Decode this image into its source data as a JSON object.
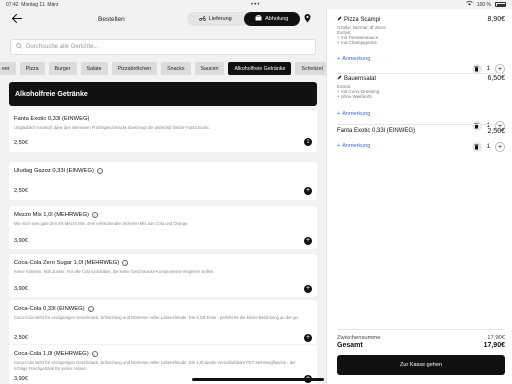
{
  "statusbar": {
    "time": "07:42",
    "date": "Montag 11. März",
    "battery": "100 %"
  },
  "header": {
    "title": "Bestellen",
    "tabs": [
      {
        "label": "Lieferung"
      },
      {
        "label": "Abholung"
      }
    ]
  },
  "search": {
    "placeholder": "Durchsuche alle Gerichte..."
  },
  "categories": [
    "eer",
    "Pizza",
    "Burger",
    "Salate",
    "Pizzabrötchen",
    "Snacks",
    "Saucen",
    "Alkoholfreie Getränke",
    "Schnitzel"
  ],
  "section": {
    "title": "Alkoholfreie Getränke"
  },
  "products": [
    {
      "name": "Fanta Exotic 0,33l (EINWEG)",
      "desc": "Unglaublich exotisch dank des intensiven Fruchtgeschmacks überzeugt die prickelnd frische Fanta Exotic.",
      "price": "2,50€",
      "qty": "1"
    },
    {
      "name": "Uludag Gazoz 0,33l (EINWEG)",
      "desc": "",
      "price": "2,50€"
    },
    {
      "name": "Mezzo Mix 1,0l (MEHRWEG)",
      "desc": "Mix mich eins gute Zeit mit Mezzo Mix, dem erfrischenden leckeren Mix aus Cola und Orange.",
      "price": "3,90€"
    },
    {
      "name": "Coca-Cola Zero Sugar 1,0l (MEHRWEG)",
      "desc": "Keine Kalorien. Null Zucker. Für alle Cola-Liebhaber, die keine Geschmacks-Kompromisse eingehen wollen.",
      "price": "3,90€"
    },
    {
      "name": "Coca-Cola 0,33l (EINWEG)",
      "desc": "Coca-Cola steht für einzigartigen Geschmack, Erfrischung und Momente voller Lebensfreude. Die 0,33l Dose - perfekt für die kleine Belohnung an der go.",
      "price": "2,50€"
    },
    {
      "name": "Coca-Cola 1,0l (MEHRWEG)",
      "desc": "Coca-Cola steht für einzigartigen Geschmack, Erfrischung und Momente voller Lebensfreude. Die 1,0l wieder verschließbare PET Mehrwegflasche - der richtige Frischgetränk für vielen Anlass.",
      "price": "3,90€"
    }
  ],
  "cart": {
    "items": [
      {
        "name": "Pizza Scampi",
        "price": "8,90€",
        "details": [
          "Größe: Normal, Ø 26cm",
          "Extras:",
          "+ mit Tomatensauce",
          "+ mit Champignons"
        ],
        "note": "Anmerkung",
        "qty": "1"
      },
      {
        "name": "Bauernsalat",
        "price": "6,50€",
        "details": [
          "Extras:",
          "+ mit Curry-Dressing",
          "+ ohne Weißkohl"
        ],
        "note": "Anmerkung",
        "qty": "1"
      },
      {
        "name": "Fanta Exotic 0,33l (EINWEG)",
        "price": "2,50€",
        "details": [],
        "note": "Anmerkung",
        "qty": "1"
      }
    ],
    "subtotal_label": "Zwischensumme",
    "subtotal": "17,90€",
    "total_label": "Gesamt",
    "total": "17,90€",
    "checkout_label": "Zur Kasse gehen"
  }
}
